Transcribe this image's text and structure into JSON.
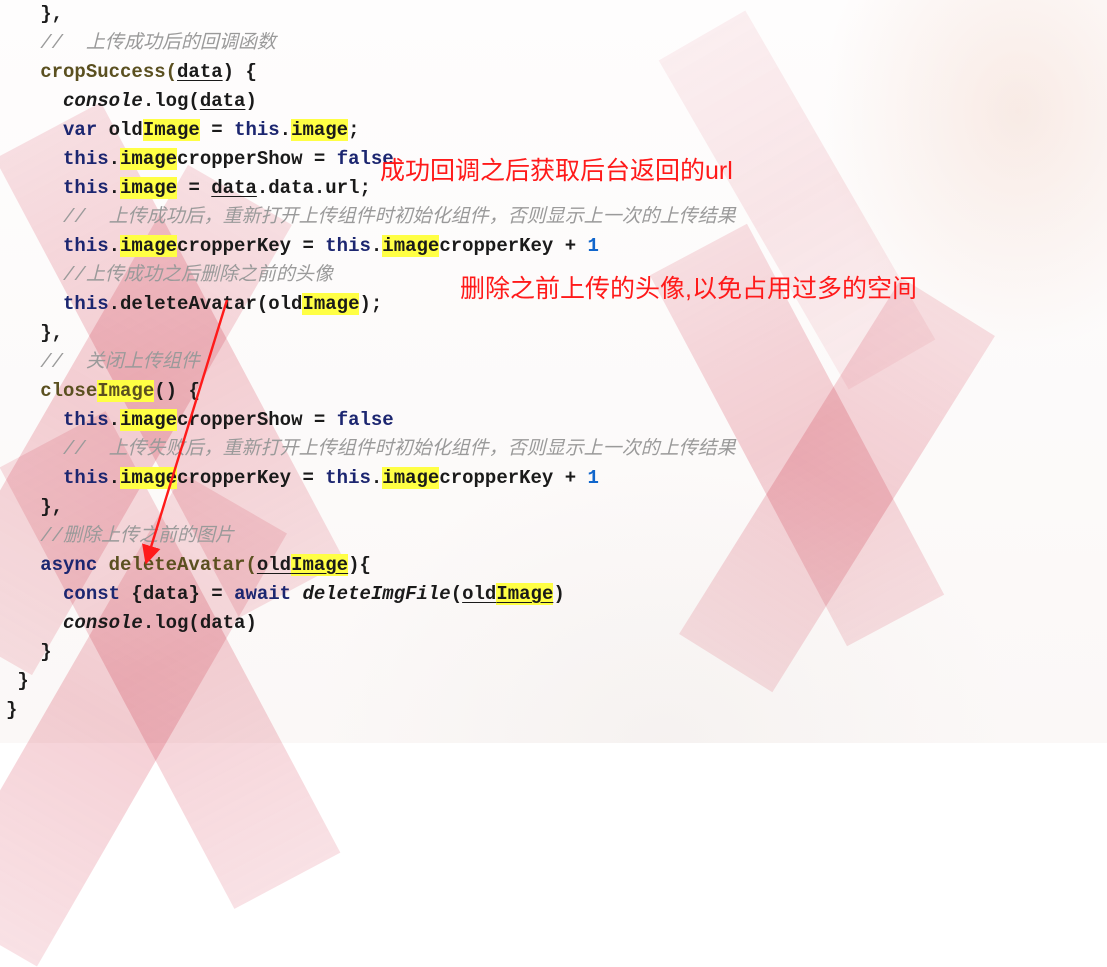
{
  "code": {
    "c0": "   },",
    "c1": "   //  上传成功后的回调函数",
    "c2_a": "   cropSuccess(",
    "c2_b": "data",
    "c2_c": ") {",
    "c3_a": "     console",
    "c3_b": ".log(",
    "c3_c": "data",
    "c3_d": ")",
    "c4_a": "     var",
    "c4_b": " old",
    "c4_c": "Image",
    "c4_d": " = ",
    "c4_e": "this",
    "c4_f": ".",
    "c4_g": "image",
    "c4_h": ";",
    "c5_a": "     this",
    "c5_b": ".",
    "c5_c": "image",
    "c5_d": "cropperShow = ",
    "c5_e": "false",
    "c6_a": "     this",
    "c6_b": ".",
    "c6_c": "image",
    "c6_d": " = ",
    "c6_e": "data",
    "c6_f": ".data.url;",
    "c7": "     //  上传成功后，重新打开上传组件时初始化组件，否则显示上一次的上传结果",
    "c8_a": "     this",
    "c8_b": ".",
    "c8_c": "image",
    "c8_d": "cropperKey = ",
    "c8_e": "this",
    "c8_f": ".",
    "c8_g": "image",
    "c8_h": "cropperKey + ",
    "c8_i": "1",
    "c9": "     //上传成功之后删除之前的头像",
    "c10_a": "     this",
    "c10_b": ".deleteAvatar(old",
    "c10_c": "Image",
    "c10_d": ");",
    "c11": "   },",
    "c12": "   //  关闭上传组件",
    "c13_a": "   close",
    "c13_b": "Image",
    "c13_c": "() {",
    "c14_a": "     this",
    "c14_b": ".",
    "c14_c": "image",
    "c14_d": "cropperShow = ",
    "c14_e": "false",
    "c15": "     //  上传失败后，重新打开上传组件时初始化组件，否则显示上一次的上传结果",
    "c16_a": "     this",
    "c16_b": ".",
    "c16_c": "image",
    "c16_d": "cropperKey = ",
    "c16_e": "this",
    "c16_f": ".",
    "c16_g": "image",
    "c16_h": "cropperKey + ",
    "c16_i": "1",
    "c17": "   },",
    "c18": "   //删除上传之前的图片",
    "c19_a": "   async",
    "c19_b": " deleteAvatar(",
    "c19_c": "old",
    "c19_d": "Image",
    "c19_e": "){",
    "c20_a": "     const",
    "c20_b": " {data} = ",
    "c20_c": "await",
    "c20_d": " deleteImgFile",
    "c20_e": "(",
    "c20_f": "old",
    "c20_g": "Image",
    "c20_h": ")",
    "c21_a": "     console",
    "c21_b": ".log(data)",
    "c22": "   }",
    "c23": " }",
    "c24": "}"
  },
  "annotations": {
    "a1": "成功回调之后获取后台返回的url",
    "a2": "删除之前上传的头像,以免占用过多的空间"
  }
}
